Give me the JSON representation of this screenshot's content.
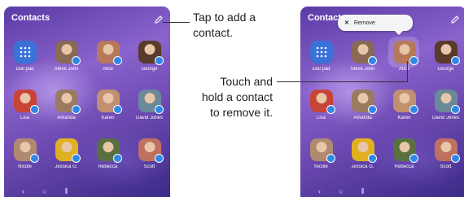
{
  "left_screen": {
    "title": "Contacts",
    "contacts": [
      {
        "name": "Dial pad",
        "type": "dialpad",
        "color": "#3a72d8"
      },
      {
        "name": "Steve John",
        "color": "#8a6a55"
      },
      {
        "name": "Alice",
        "color": "#b8795a"
      },
      {
        "name": "George",
        "color": "#5a3a2a"
      },
      {
        "name": "Lisa",
        "color": "#c84436"
      },
      {
        "name": "Amanda",
        "color": "#9a7a60"
      },
      {
        "name": "Karen",
        "color": "#c09070"
      },
      {
        "name": "David Jones",
        "color": "#6a8a9a"
      },
      {
        "name": "Nicole",
        "color": "#b08a70"
      },
      {
        "name": "Jessica G.",
        "color": "#e0b020"
      },
      {
        "name": "Rebecca",
        "color": "#5a7040"
      },
      {
        "name": "Scott",
        "color": "#c07060"
      }
    ]
  },
  "right_screen": {
    "title": "Contacts",
    "popup_label": "Remove",
    "contacts": [
      {
        "name": "Dial pad",
        "type": "dialpad",
        "color": "#3a72d8"
      },
      {
        "name": "Steve John",
        "color": "#8a6a55"
      },
      {
        "name": "Alice",
        "color": "#b8795a"
      },
      {
        "name": "George",
        "color": "#5a3a2a"
      },
      {
        "name": "Lisa",
        "color": "#c84436"
      },
      {
        "name": "Amanda",
        "color": "#9a7a60"
      },
      {
        "name": "Karen",
        "color": "#c09070"
      },
      {
        "name": "David Jones",
        "color": "#6a8a9a"
      },
      {
        "name": "Nicole",
        "color": "#b08a70"
      },
      {
        "name": "Jessica G.",
        "color": "#e0b020"
      },
      {
        "name": "Rebecca",
        "color": "#5a7040"
      },
      {
        "name": "Scott",
        "color": "#c07060"
      }
    ]
  },
  "nav_icons": {
    "back": "‹",
    "home": "○",
    "recents": "⦀"
  },
  "callouts": {
    "add_line1": "Tap to add a",
    "add_line2": "contact.",
    "remove_line1": "Touch and",
    "remove_line2": "hold a contact",
    "remove_line3": "to remove it."
  }
}
